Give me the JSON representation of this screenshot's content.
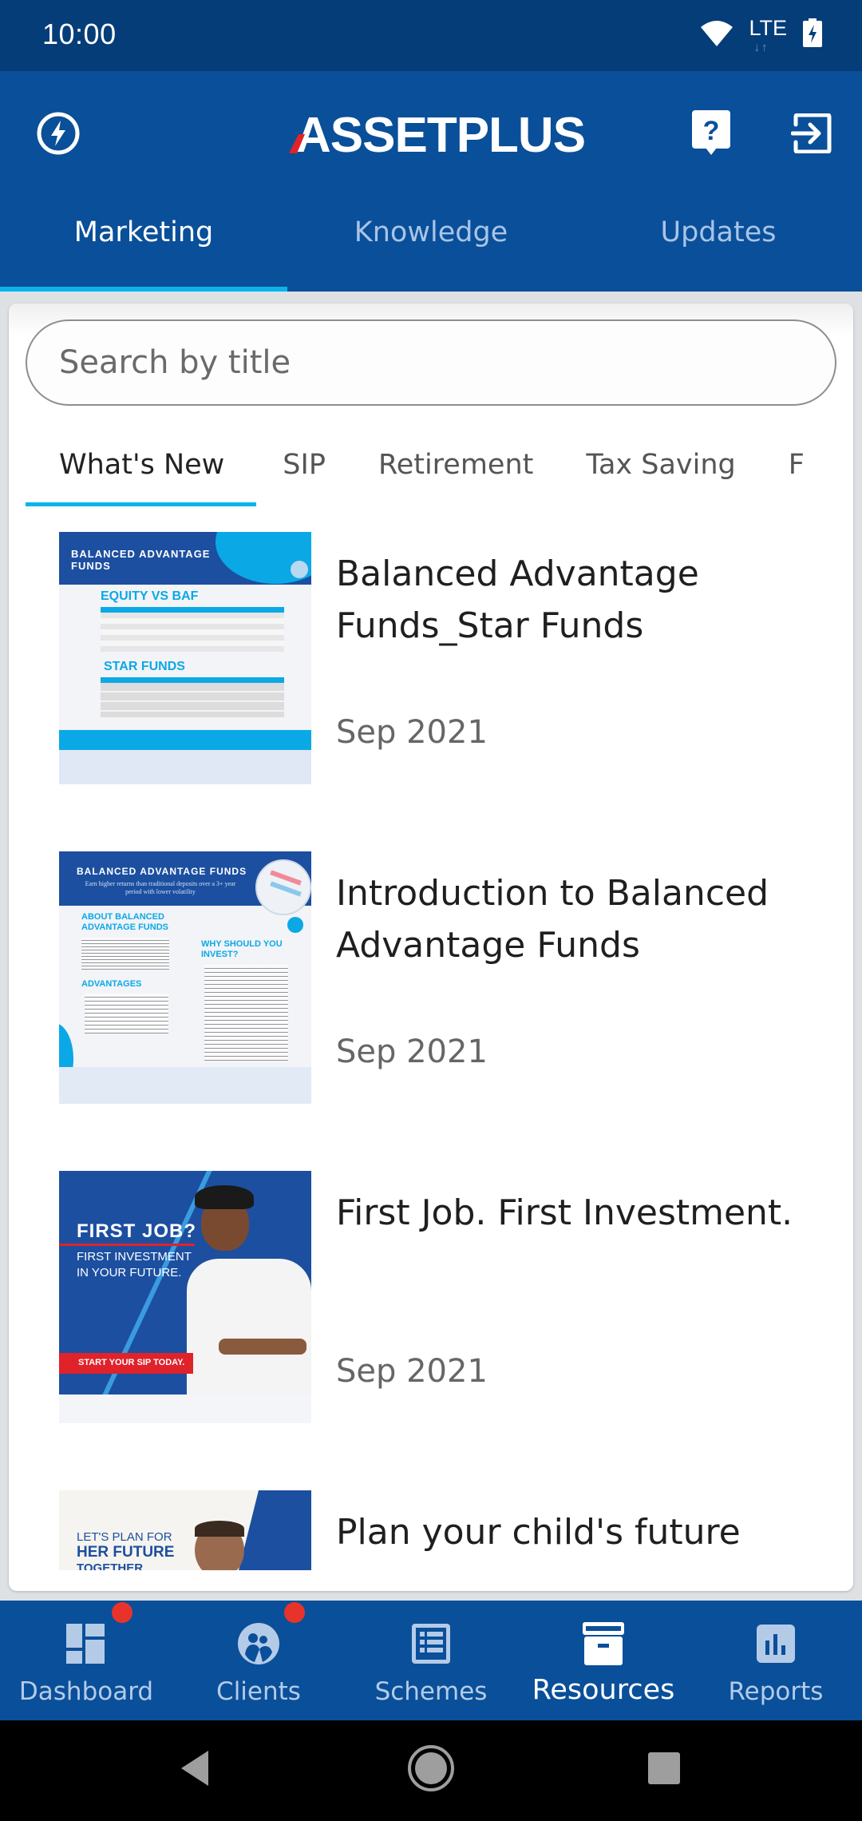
{
  "status_bar": {
    "time": "10:00",
    "network": "LTE",
    "icons": [
      "wifi-icon",
      "lte-icon",
      "battery-charging-icon"
    ]
  },
  "header": {
    "logo": "ASSETPLUS",
    "left_icon": "lightning-icon",
    "right_icons": [
      "help-chat-icon",
      "logout-icon"
    ],
    "tabs": [
      {
        "label": "Marketing",
        "active": true
      },
      {
        "label": "Knowledge",
        "active": false
      },
      {
        "label": "Updates",
        "active": false
      }
    ]
  },
  "search": {
    "placeholder": "Search by title",
    "value": ""
  },
  "categories": [
    {
      "label": "What's New",
      "active": true
    },
    {
      "label": "SIP",
      "active": false
    },
    {
      "label": "Retirement",
      "active": false
    },
    {
      "label": "Tax Saving",
      "active": false
    },
    {
      "label": "F",
      "active": false
    }
  ],
  "items": [
    {
      "title": "Balanced Advantage Funds_Star Funds",
      "date": "Sep 2021",
      "thumb": {
        "heading": "BALANCED ADVANTAGE FUNDS",
        "sub1": "EQUITY VS BAF",
        "sub2": "STAR FUNDS"
      }
    },
    {
      "title": "Introduction to Balanced Advantage Funds",
      "date": "Sep 2021",
      "thumb": {
        "heading": "BALANCED ADVANTAGE FUNDS",
        "tagline": "Earn higher returns than traditional deposits over a 3+ year period with lower volatility",
        "sub1": "ABOUT BALANCED ADVANTAGE FUNDS",
        "sub2": "ADVANTAGES",
        "sub3": "WHY SHOULD YOU INVEST?"
      }
    },
    {
      "title": "First Job. First Investment.",
      "date": "Sep 2021",
      "thumb": {
        "heading": "FIRST JOB?",
        "sub1": "FIRST INVESTMENT IN YOUR FUTURE.",
        "cta": "START YOUR SIP TODAY."
      }
    },
    {
      "title": "Plan your child's future",
      "date": "",
      "thumb": {
        "line1": "LET'S PLAN FOR",
        "line2": "HER FUTURE",
        "line3": "TOGETHER"
      }
    }
  ],
  "bottom_nav": [
    {
      "label": "Dashboard",
      "icon": "dashboard-icon",
      "badge": true,
      "active": false
    },
    {
      "label": "Clients",
      "icon": "clients-icon",
      "badge": true,
      "active": false
    },
    {
      "label": "Schemes",
      "icon": "schemes-icon",
      "badge": false,
      "active": false
    },
    {
      "label": "Resources",
      "icon": "resources-icon",
      "badge": false,
      "active": true
    },
    {
      "label": "Reports",
      "icon": "reports-icon",
      "badge": false,
      "active": false
    }
  ],
  "colors": {
    "primary": "#0a4f99",
    "status_bar": "#053d78",
    "accent": "#0bb3ea",
    "badge": "#e8332b",
    "logo_accent": "#e0222a"
  }
}
